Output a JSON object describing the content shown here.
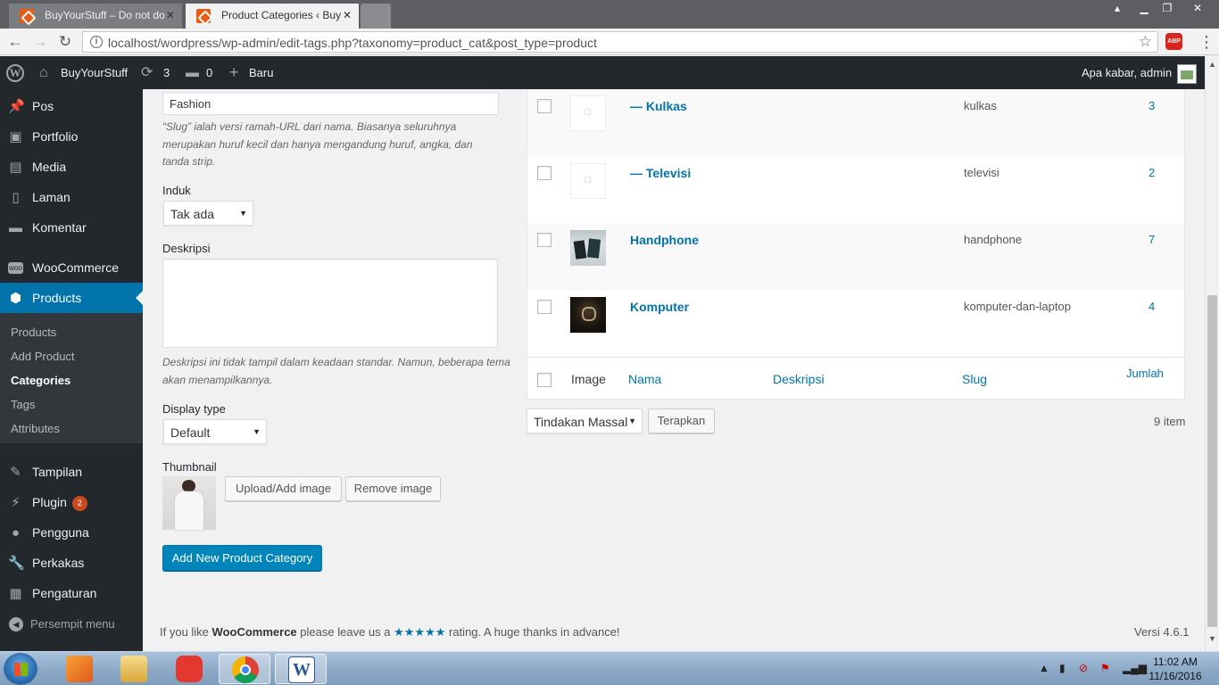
{
  "browser": {
    "tabs": [
      {
        "title": "BuyYourStuff – Do not do",
        "active": false
      },
      {
        "title": "Product Categories ‹ Buy",
        "active": true
      }
    ],
    "url": "localhost/wordpress/wp-admin/edit-tags.php?taxonomy=product_cat&post_type=product",
    "abp_label": "ABP"
  },
  "adminbar": {
    "site_name": "BuyYourStuff",
    "updates_count": "3",
    "comments_count": "0",
    "new_label": "Baru",
    "greeting": "Apa kabar, admin"
  },
  "sidebar": {
    "items": [
      {
        "label": "Pos",
        "icon": "pin-icon"
      },
      {
        "label": "Portfolio",
        "icon": "portfolio-icon"
      },
      {
        "label": "Media",
        "icon": "media-icon"
      },
      {
        "label": "Laman",
        "icon": "page-icon"
      },
      {
        "label": "Komentar",
        "icon": "comment-icon"
      },
      {
        "label": "WooCommerce",
        "icon": "woocommerce-icon"
      },
      {
        "label": "Products",
        "icon": "box-icon"
      }
    ],
    "submenu": [
      {
        "label": "Products"
      },
      {
        "label": "Add Product"
      },
      {
        "label": "Categories"
      },
      {
        "label": "Tags"
      },
      {
        "label": "Attributes"
      }
    ],
    "items2": [
      {
        "label": "Tampilan",
        "icon": "brush-icon"
      },
      {
        "label": "Plugin",
        "icon": "plugin-icon",
        "badge": "2"
      },
      {
        "label": "Pengguna",
        "icon": "user-icon"
      },
      {
        "label": "Perkakas",
        "icon": "wrench-icon"
      },
      {
        "label": "Pengaturan",
        "icon": "settings-icon"
      }
    ],
    "collapse_label": "Persempit menu"
  },
  "form": {
    "slug_value": "Fashion",
    "slug_help": "“Slug” ialah versi ramah-URL dari nama. Biasanya seluruhnya merupakan huruf kecil dan hanya mengandung huruf, angka, dan tanda strip.",
    "parent_label": "Induk",
    "parent_value": "Tak ada",
    "description_label": "Deskripsi",
    "description_value": "",
    "description_help": "Deskripsi ini tidak tampil dalam keadaan standar. Namun, beberapa tema akan menampilkannya.",
    "display_type_label": "Display type",
    "display_type_value": "Default",
    "thumbnail_label": "Thumbnail",
    "upload_button": "Upload/Add image",
    "remove_button": "Remove image",
    "submit_button": "Add New Product Category"
  },
  "table": {
    "rows": [
      {
        "name": "— Kulkas",
        "slug": "kulkas",
        "count": "3",
        "thumb": "placeholder"
      },
      {
        "name": "— Televisi",
        "slug": "televisi",
        "count": "2",
        "thumb": "placeholder"
      },
      {
        "name": "Handphone",
        "slug": "handphone",
        "count": "7",
        "thumb": "phone"
      },
      {
        "name": "Komputer",
        "slug": "komputer-dan-laptop",
        "count": "4",
        "thumb": "laptop"
      }
    ],
    "footer": {
      "image": "Image",
      "name": "Nama",
      "description": "Deskripsi",
      "slug": "Slug",
      "count": "Jumlah"
    },
    "bulk_action": "Tindakan Massal",
    "apply_button": "Terapkan",
    "items_count": "9 item"
  },
  "footer": {
    "text_before": "If you like",
    "brand": "WooCommerce",
    "text_middle": "please leave us a",
    "stars": "★★★★★",
    "text_after": "rating. A huge thanks in advance!",
    "version": "Versi 4.6.1"
  },
  "taskbar": {
    "time": "11:02 AM",
    "date": "11/16/2016",
    "word_label": "W"
  }
}
